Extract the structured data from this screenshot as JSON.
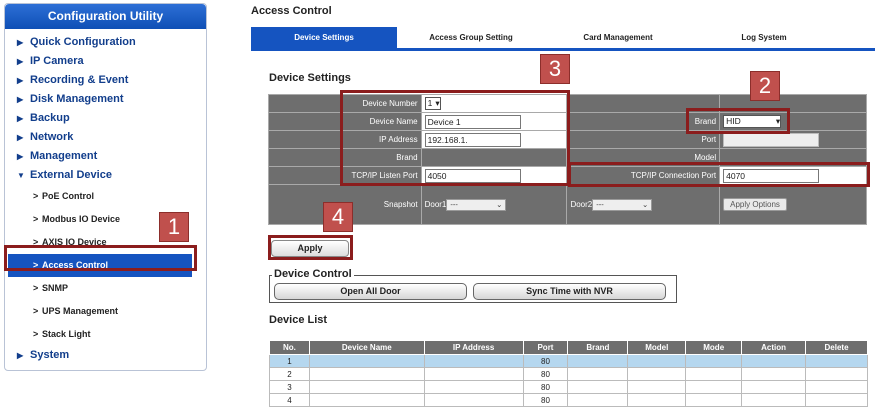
{
  "sidebar": {
    "title": "Configuration Utility",
    "items": [
      {
        "label": "Quick Configuration"
      },
      {
        "label": "IP Camera"
      },
      {
        "label": "Recording & Event"
      },
      {
        "label": "Disk Management"
      },
      {
        "label": "Backup"
      },
      {
        "label": "Network"
      },
      {
        "label": "Management"
      },
      {
        "label": "External Device"
      }
    ],
    "sub_items": [
      {
        "label": "PoE Control"
      },
      {
        "label": "Modbus IO Device"
      },
      {
        "label": "AXIS IO Device"
      },
      {
        "label": "Access Control"
      },
      {
        "label": "SNMP"
      },
      {
        "label": "UPS Management"
      },
      {
        "label": "Stack Light"
      }
    ],
    "last_item": {
      "label": "System"
    }
  },
  "callouts": [
    "1",
    "2",
    "3",
    "4"
  ],
  "page_title": "Access Control",
  "tabs": [
    {
      "label": "Device Settings"
    },
    {
      "label": "Access Group Setting"
    },
    {
      "label": "Card Management"
    },
    {
      "label": "Log System"
    }
  ],
  "device_settings": {
    "title": "Device Settings",
    "device_number_label": "Device Number",
    "device_number_value": "1",
    "device_name_label": "Device Name",
    "device_name_value": "Device 1",
    "ip_label": "IP Address",
    "ip_value": "192.168.1.",
    "brand_label": "Brand",
    "brand_label_right": "Brand",
    "brand_value": "HID",
    "port_label": "Port",
    "model_label": "Model",
    "tcp_listen_label": "TCP/IP Listen Port",
    "tcp_listen_value": "4050",
    "tcp_conn_label": "TCP/IP Connection Port",
    "tcp_conn_value": "4070",
    "snapshot_label": "Snapshot",
    "door1_label": "Door1",
    "door1_value": "---",
    "door2_label": "Door2",
    "door2_value": "---",
    "apply_options": "Apply Options"
  },
  "apply_button": "Apply",
  "device_control": {
    "legend": "Device Control",
    "open_all": "Open All Door",
    "sync_time": "Sync Time with NVR"
  },
  "device_list": {
    "title": "Device List",
    "columns": [
      "No.",
      "Device Name",
      "IP Address",
      "Port",
      "Brand",
      "Model",
      "Mode",
      "Action",
      "Delete"
    ],
    "rows": [
      [
        "1",
        "",
        "",
        "80",
        "",
        "",
        "",
        "",
        ""
      ],
      [
        "2",
        "",
        "",
        "80",
        "",
        "",
        "",
        "",
        ""
      ],
      [
        "3",
        "",
        "",
        "80",
        "",
        "",
        "",
        "",
        ""
      ],
      [
        "4",
        "",
        "",
        "80",
        "",
        "",
        "",
        "",
        ""
      ]
    ]
  },
  "colors": {
    "accent": "#1554c0",
    "callout": "#c0504d",
    "highlight_border": "#8b1d1d",
    "label_bg": "#6e6e6e",
    "selected_row": "#b5d7ef"
  }
}
